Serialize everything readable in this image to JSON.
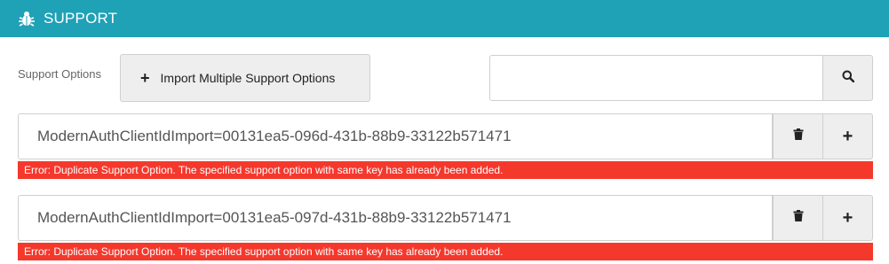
{
  "header": {
    "title": "SUPPORT",
    "icon": "bug-icon"
  },
  "toolbar": {
    "options_label": "Support Options",
    "import_label": "Import Multiple Support Options",
    "search_value": "",
    "search_icon": "search-icon"
  },
  "rows": [
    {
      "value": "ModernAuthClientIdImport=00131ea5-096d-431b-88b9-33122b571471",
      "error": "Error: Duplicate Support Option. The specified support option with same key has already been added."
    },
    {
      "value": "ModernAuthClientIdImport=00131ea5-097d-431b-88b9-33122b571471",
      "error": "Error: Duplicate Support Option. The specified support option with same key has already been added."
    }
  ],
  "colors": {
    "header": "#1fa1b6",
    "error": "#f5382c",
    "button": "#eeeeee"
  }
}
